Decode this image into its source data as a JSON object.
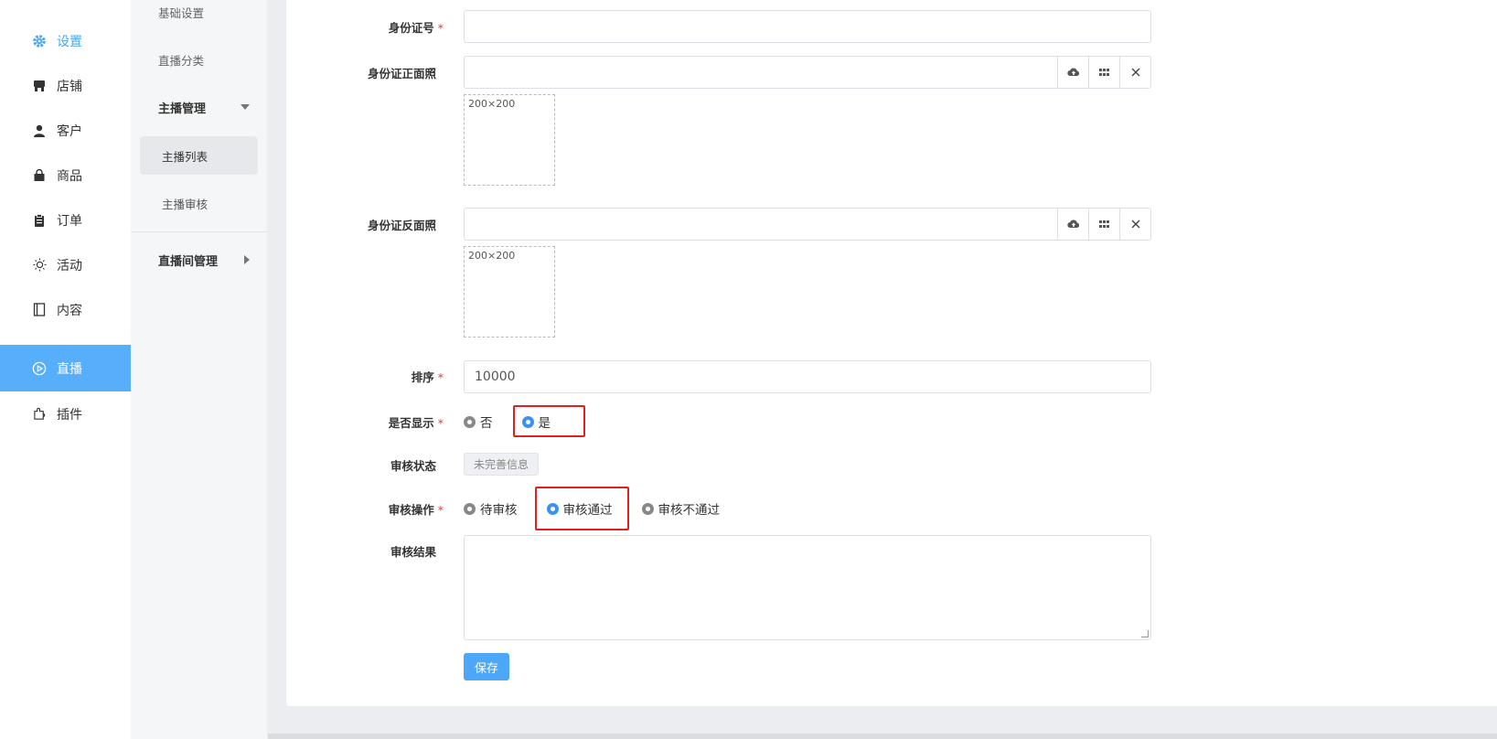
{
  "nav": {
    "items": [
      {
        "label": "设置",
        "icon": "gear-icon"
      },
      {
        "label": "店铺",
        "icon": "store-icon"
      },
      {
        "label": "客户",
        "icon": "user-icon"
      },
      {
        "label": "商品",
        "icon": "shopping-bag-icon"
      },
      {
        "label": "订单",
        "icon": "clipboard-icon"
      },
      {
        "label": "活动",
        "icon": "sun-icon"
      },
      {
        "label": "内容",
        "icon": "book-icon"
      },
      {
        "label": "直播",
        "icon": "play-circle-icon"
      },
      {
        "label": "插件",
        "icon": "puzzle-icon"
      }
    ],
    "active_index": 7,
    "accent_color": "#4aa6f5",
    "active_bg": "#57aefb"
  },
  "subnav": {
    "basic_settings": "基础设置",
    "live_category": "直播分类",
    "anchor_mgmt": "主播管理",
    "anchor_list": "主播列表",
    "anchor_review": "主播审核",
    "room_mgmt": "直播间管理"
  },
  "form": {
    "id_number": {
      "label": "身份证号",
      "value": ""
    },
    "id_front": {
      "label": "身份证正面照",
      "value": "",
      "thumb_text": "200×200"
    },
    "id_back": {
      "label": "身份证反面照",
      "value": "",
      "thumb_text": "200×200"
    },
    "sort": {
      "label": "排序",
      "value": "10000"
    },
    "display": {
      "label": "是否显示",
      "options": [
        "否",
        "是"
      ],
      "selected": "是"
    },
    "review_status": {
      "label": "审核状态",
      "value": "未完善信息"
    },
    "review_action": {
      "label": "审核操作",
      "options": [
        "待审核",
        "审核通过",
        "审核不通过"
      ],
      "selected": "审核通过"
    },
    "review_result": {
      "label": "审核结果",
      "value": ""
    },
    "save_label": "保存",
    "required_mark": "*"
  }
}
